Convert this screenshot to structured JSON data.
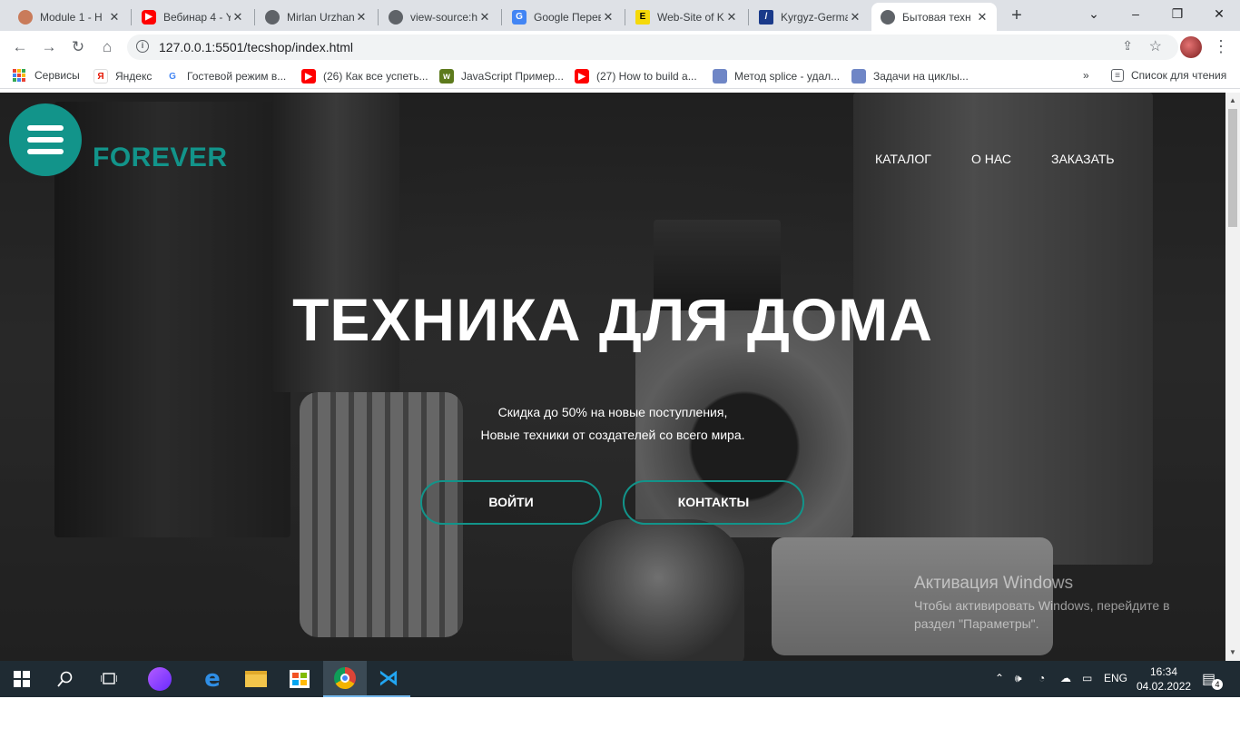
{
  "browser": {
    "tabs": [
      {
        "title": "Module 1 - H",
        "icon_color": "#c97b5a"
      },
      {
        "title": "Вебинар 4 - Y",
        "icon_color": "#ff0000"
      },
      {
        "title": "Mirlan Urzhan",
        "icon_color": "#5f6368"
      },
      {
        "title": "view-source:h",
        "icon_color": "#5f6368"
      },
      {
        "title": "Google Перев",
        "icon_color": "#4285f4"
      },
      {
        "title": "Web-Site of K",
        "icon_color": "#f5d90a"
      },
      {
        "title": "Kyrgyz-Germa",
        "icon_color": "#1a3a8a"
      },
      {
        "title": "Бытовая техн",
        "icon_color": "#5f6368"
      }
    ],
    "new_tab": "+",
    "window_controls": {
      "minimize": "–",
      "restore": "❐",
      "close": "✕",
      "tab_search": "⌄"
    },
    "url": "127.0.0.1:5501/tecshop/index.html",
    "bookmarks": [
      {
        "label": "Сервисы"
      },
      {
        "label": "Яндекс"
      },
      {
        "label": "Гостевой режим в..."
      },
      {
        "label": "(26) Как все успеть..."
      },
      {
        "label": "JavaScript Пример..."
      },
      {
        "label": "(27) How to build a..."
      },
      {
        "label": "Метод splice - удал..."
      },
      {
        "label": "Задачи на циклы..."
      }
    ],
    "reading_list": "Список для чтения",
    "more_bookmarks": "»"
  },
  "site": {
    "brand": "FOREVER",
    "nav": [
      "КАТАЛОГ",
      "О НАС",
      "ЗАКАЗАТЬ"
    ],
    "hero_title": "ТЕХНИКА ДЛЯ ДОМА",
    "hero_line1": "Скидка до 50% на новые поступления,",
    "hero_line2": "Новые техники от создателей со всего мира.",
    "btn_login": "ВОЙТИ",
    "btn_contacts": "КОНТАКТЫ",
    "accent": "#12948a"
  },
  "watermark": {
    "title": "Активация Windows",
    "text": "Чтобы активировать Windows, перейдите в раздел \"Параметры\"."
  },
  "taskbar": {
    "lang": "ENG",
    "time": "16:34",
    "date": "04.02.2022",
    "notifications": "4"
  }
}
